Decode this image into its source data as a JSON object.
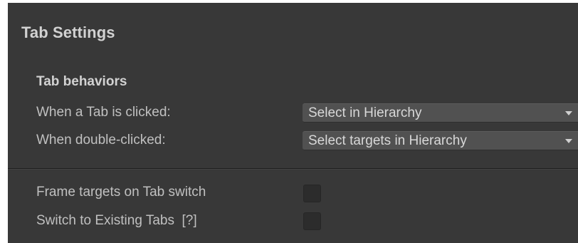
{
  "panel": {
    "title": "Tab Settings"
  },
  "tab_behaviors": {
    "heading": "Tab behaviors",
    "on_click": {
      "label": "When a Tab is clicked:",
      "value": "Select in Hierarchy"
    },
    "on_double_click": {
      "label": "When double-clicked:",
      "value": "Select targets in Hierarchy"
    }
  },
  "options": {
    "frame_targets": {
      "label": "Frame targets on Tab switch",
      "checked": false
    },
    "switch_existing": {
      "label": "Switch to Existing Tabs  [?]",
      "checked": false
    }
  },
  "colors": {
    "panel_background": "#383838",
    "dropdown_background": "#515151",
    "checkbox_background": "#2c2c2c"
  }
}
